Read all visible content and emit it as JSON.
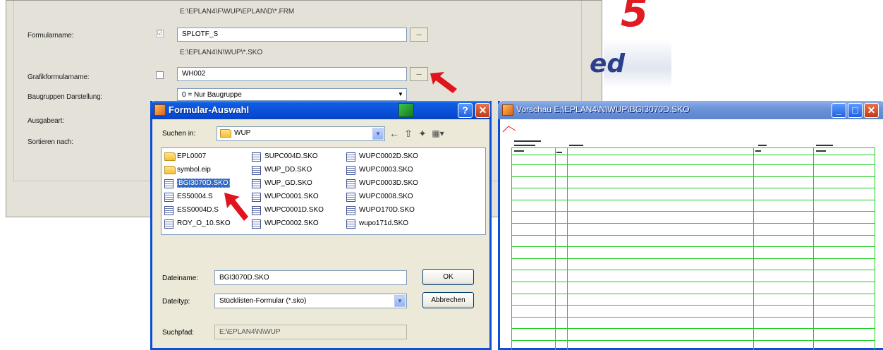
{
  "background_dialog": {
    "path_top": "E:\\EPLAN4\\F\\WUP\\EPLAN\\D\\*.FRM",
    "formular_label": "Formularname:",
    "formular_checked": "☑",
    "formular_value": "SPLOTF_S",
    "path_mid": "E:\\EPLAN4\\N\\WUP\\*.SKO",
    "grafik_label": "Grafikformularname:",
    "grafik_value": "WH002",
    "baugruppen_label": "Baugruppen Darstellung:",
    "baugruppen_value": "0 = Nur Baugruppe",
    "ausgabe_label": "Ausgabeart:",
    "sortieren_label": "Sortieren nach:",
    "browse_label": "..."
  },
  "logo": {
    "five": "5",
    "ed": "ed"
  },
  "formular_dialog": {
    "title": "Formular-Auswahl",
    "help_btn": "?",
    "close_btn": "✕",
    "look_in_label": "Suchen in:",
    "look_in_value": "WUP",
    "files_col1": [
      {
        "name": "EPL0007",
        "type": "folder"
      },
      {
        "name": "symbol.eip",
        "type": "folder"
      },
      {
        "name": "BGI3070D.SKO",
        "type": "file",
        "selected": true
      },
      {
        "name": "ES50004.S",
        "type": "file"
      },
      {
        "name": "ESS0004D.S",
        "type": "file"
      },
      {
        "name": "ROY_O_10.SKO",
        "type": "file"
      }
    ],
    "files_col2": [
      {
        "name": "SUPC004D.SKO",
        "type": "file"
      },
      {
        "name": "WUP_DD.SKO",
        "type": "file"
      },
      {
        "name": "WUP_GD.SKO",
        "type": "file"
      },
      {
        "name": "WUPC0001.SKO",
        "type": "file"
      },
      {
        "name": "WUPC0001D.SKO",
        "type": "file"
      },
      {
        "name": "WUPC0002.SKO",
        "type": "file"
      }
    ],
    "files_col3": [
      {
        "name": "WUPC0002D.SKO",
        "type": "file"
      },
      {
        "name": "WUPC0003.SKO",
        "type": "file"
      },
      {
        "name": "WUPC0003D.SKO",
        "type": "file"
      },
      {
        "name": "WUPC0008.SKO",
        "type": "file"
      },
      {
        "name": "WUPO170D.SKO",
        "type": "file"
      },
      {
        "name": "wupo171d.SKO",
        "type": "file"
      }
    ],
    "filename_label": "Dateiname:",
    "filename_value": "BGI3070D.SKO",
    "filetype_label": "Dateityp:",
    "filetype_value": "Stücklisten-Formular (*.sko)",
    "searchpath_label": "Suchpfad:",
    "searchpath_value": "E:\\EPLAN4\\N\\WUP",
    "ok_label": "OK",
    "cancel_label": "Abbrechen"
  },
  "preview_window": {
    "title": "Vorschau E:\\EPLAN4\\N\\WUP\\BGI3070D.SKO",
    "min_btn": "_",
    "max_btn": "□",
    "close_btn": "✕"
  },
  "colors": {
    "xp_blue": "#0a50d8",
    "grid_green": "#22cc22",
    "arrow_red": "#e0141c",
    "selection_blue": "#316ac5"
  }
}
